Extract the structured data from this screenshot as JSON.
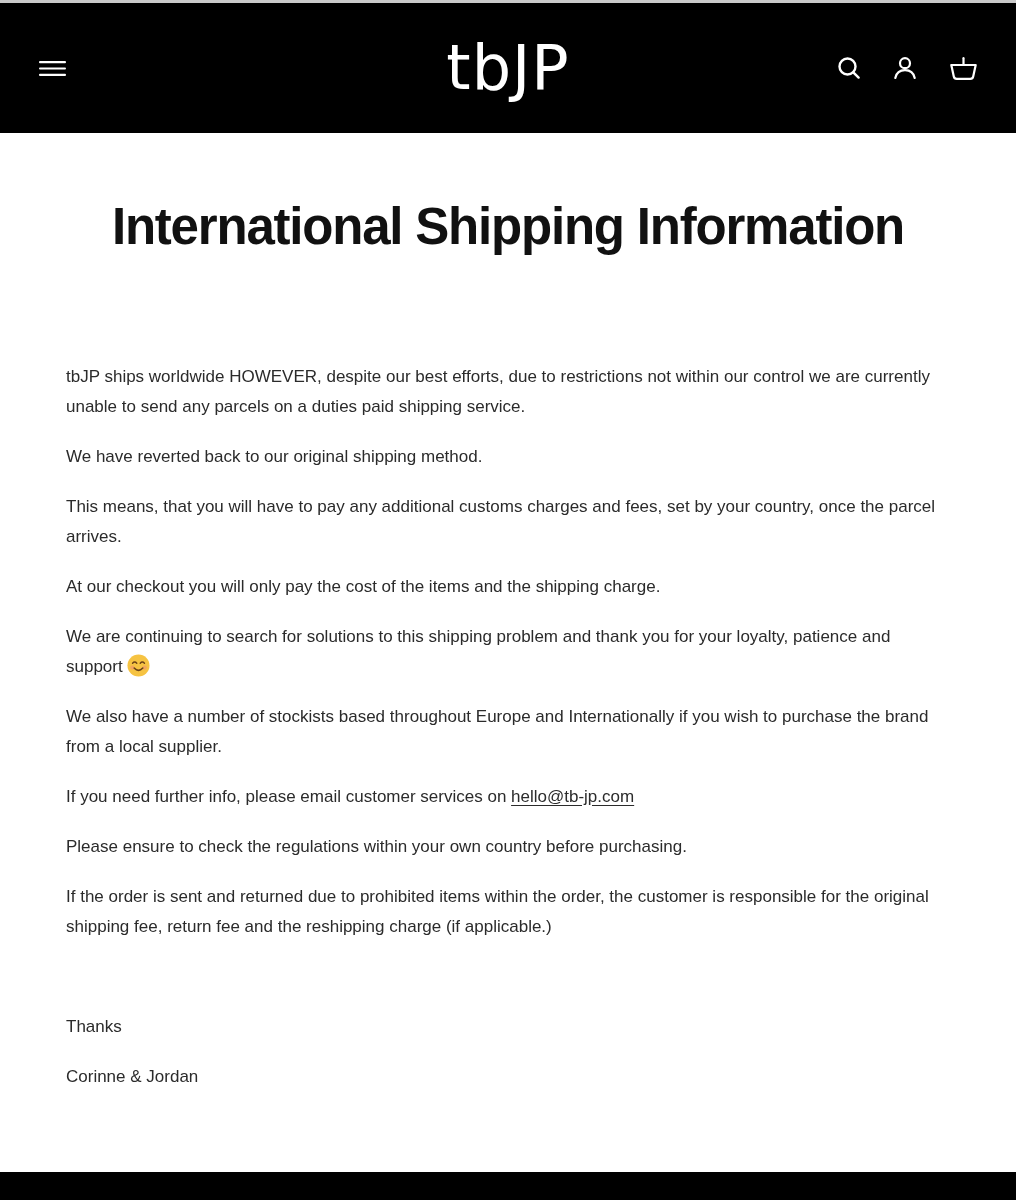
{
  "header": {
    "logo": "tbJP"
  },
  "page": {
    "title": "International Shipping Information",
    "paragraphs": [
      {
        "kind": "text",
        "text": "tbJP ships worldwide HOWEVER, despite our best efforts, due to restrictions not within our control we are currently unable to send any parcels on a duties paid shipping service."
      },
      {
        "kind": "text",
        "text": "We have reverted back to our original shipping method."
      },
      {
        "kind": "text",
        "text": "This means, that you will have to pay any additional customs charges and fees, set by your country, once the parcel arrives."
      },
      {
        "kind": "text",
        "text": "At our checkout you will only pay the cost of the items and the shipping charge."
      },
      {
        "kind": "emoji",
        "text": "We are continuing to search for solutions to this shipping problem and thank you for your loyalty, patience and support"
      },
      {
        "kind": "text",
        "text": "We also have a number of stockists based throughout Europe and Internationally if you wish to purchase the brand from a local supplier."
      },
      {
        "kind": "email",
        "text": "If you need further info, please email customer services on",
        "link": "hello@tb-jp.com"
      },
      {
        "kind": "text",
        "text": "Please ensure to check the regulations within your own country before purchasing."
      },
      {
        "kind": "text",
        "text": "If the order is sent and returned due to prohibited items within the order, the customer is responsible for the original shipping fee, return fee and the reshipping charge (if applicable.)"
      }
    ],
    "signoff": [
      "Thanks",
      "Corinne & Jordan"
    ]
  }
}
